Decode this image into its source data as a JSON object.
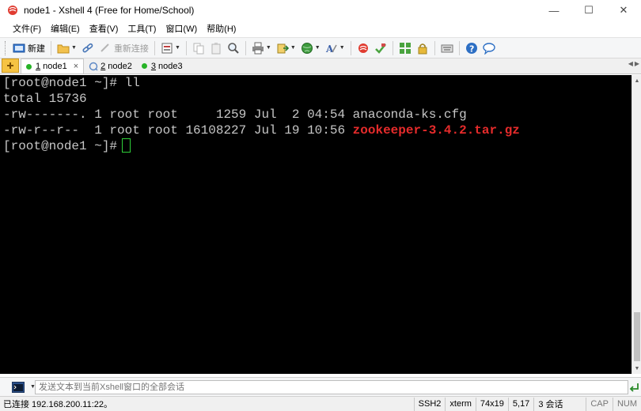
{
  "window": {
    "title": "node1 - Xshell 4 (Free for Home/School)",
    "minimize_glyph": "—",
    "maximize_glyph": "☐",
    "close_glyph": "✕"
  },
  "menu": {
    "items": [
      "文件(F)",
      "编辑(E)",
      "查看(V)",
      "工具(T)",
      "窗口(W)",
      "帮助(H)"
    ]
  },
  "toolbar": {
    "new_label": "新建",
    "reconnect_label": "重新连接"
  },
  "tabs": [
    {
      "number": "1",
      "name": "node1",
      "active": true,
      "dot_color": "#27b327",
      "close": "×"
    },
    {
      "number": "2",
      "name": "node2",
      "active": false
    },
    {
      "number": "3",
      "name": "node3",
      "active": false,
      "dot_color": "#27b327"
    }
  ],
  "terminal": {
    "lines": [
      "[root@node1 ~]# ll",
      "total 15736",
      "-rw-------. 1 root root     1259 Jul  2 04:54 anaconda-ks.cfg"
    ],
    "line4_prefix": "-rw-r--r--  1 root root 16108227 Jul 19 10:56 ",
    "line4_file": "zookeeper-3.4.2.tar.gz",
    "prompt": "[root@node1 ~]#",
    "file_color": "#e52b2b",
    "cursor_color": "#2fd13a"
  },
  "compose": {
    "placeholder": "发送文本到当前Xshell窗口的全部会话"
  },
  "status": {
    "connection": "已连接 192.168.200.11:22。",
    "protocol": "SSH2",
    "terminal_type": "xterm",
    "size": "74x19",
    "cursor_pos": "5,17",
    "sessions": "3 会话",
    "cap": "CAP",
    "num": "NUM"
  }
}
